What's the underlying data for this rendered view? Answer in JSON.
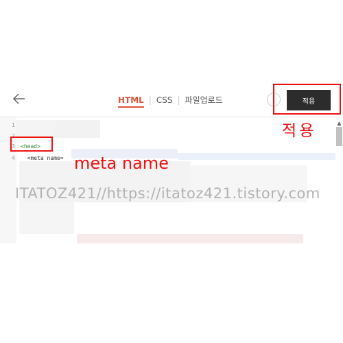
{
  "header": {
    "tabs": [
      {
        "label": "HTML",
        "active": true
      },
      {
        "label": "CSS",
        "active": false
      },
      {
        "label": "파일업로드",
        "active": false
      }
    ],
    "apply_label": "적용"
  },
  "editor": {
    "lines": [
      {
        "number": "1",
        "code": ""
      },
      {
        "number": "2",
        "code": ""
      },
      {
        "number": "3",
        "code": "<head>"
      },
      {
        "number": "4",
        "code": "  <meta name="
      }
    ]
  },
  "annotations": {
    "apply_label": "적용",
    "meta_label": "meta name",
    "watermark": "ITATOZ421//https://itatoz421.tistory.com"
  },
  "colors": {
    "accent": "#e0533a",
    "annotation": "#ee1111",
    "apply_button": "#2c2c2c"
  }
}
